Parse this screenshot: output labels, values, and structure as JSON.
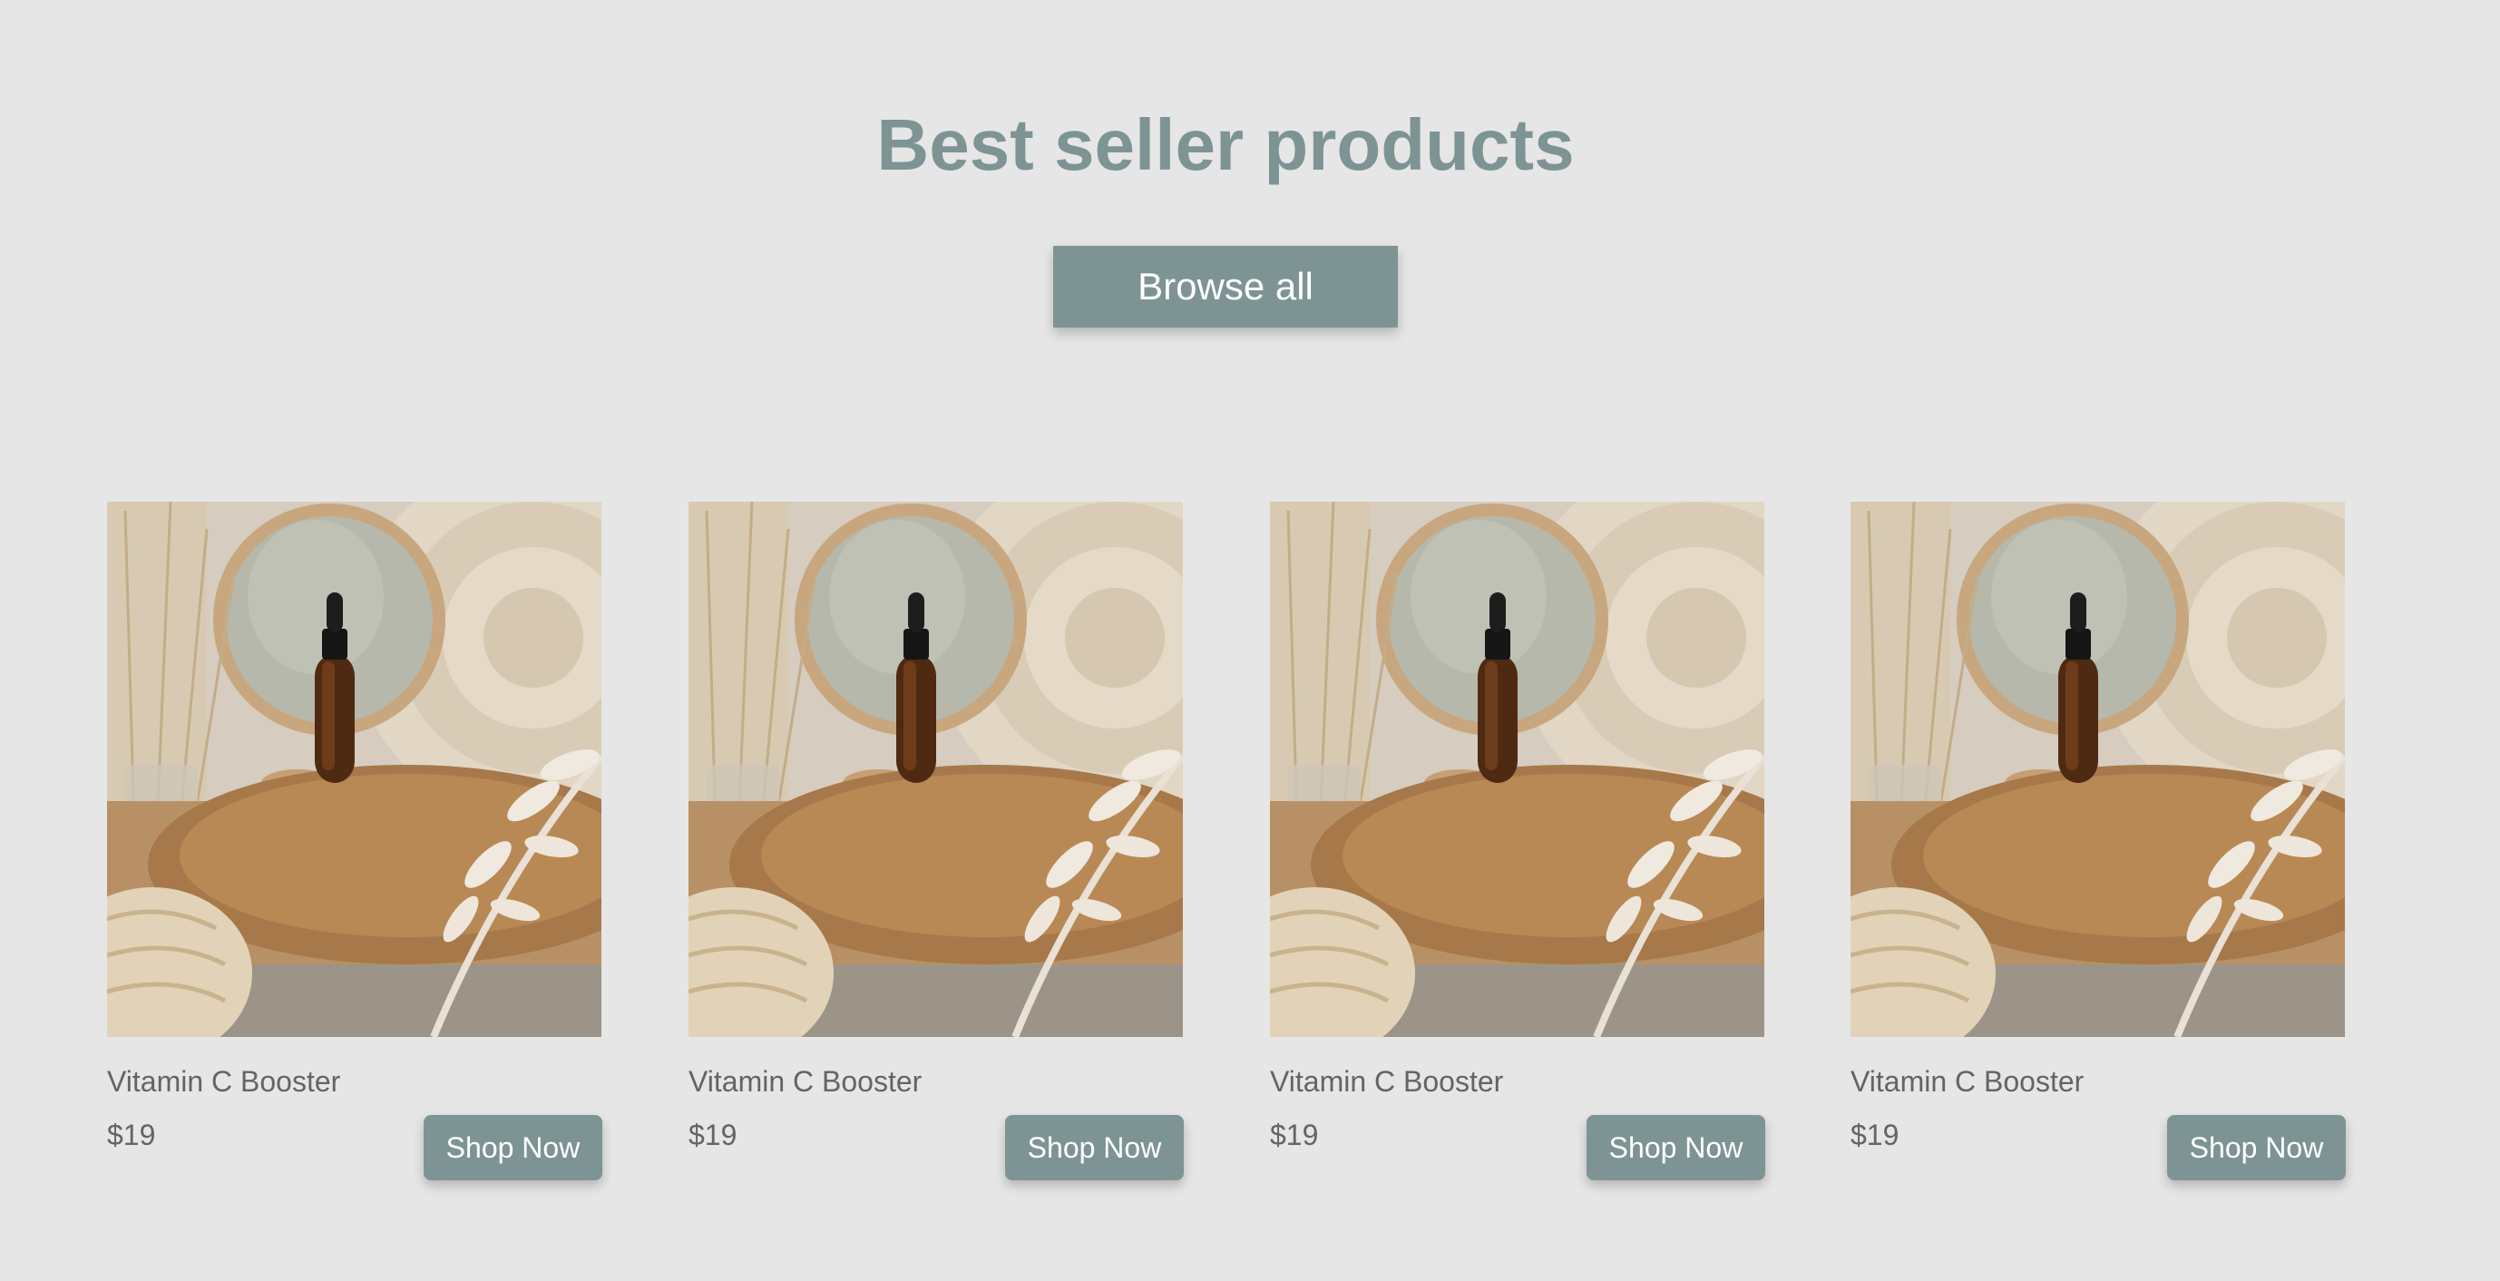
{
  "section": {
    "title": "Best seller products",
    "browse_label": "Browse all"
  },
  "products": [
    {
      "name": "Vitamin C Booster",
      "price": "$19",
      "cta": "Shop Now",
      "image_icon": "serum-bottle-photo"
    },
    {
      "name": "Vitamin C Booster",
      "price": "$19",
      "cta": "Shop Now",
      "image_icon": "serum-bottle-photo"
    },
    {
      "name": "Vitamin C Booster",
      "price": "$19",
      "cta": "Shop Now",
      "image_icon": "serum-bottle-photo"
    },
    {
      "name": "Vitamin C Booster",
      "price": "$19",
      "cta": "Shop Now",
      "image_icon": "serum-bottle-photo"
    }
  ],
  "colors": {
    "accent": "#7e9494",
    "background": "#e6e6e6",
    "text": "#646464"
  }
}
